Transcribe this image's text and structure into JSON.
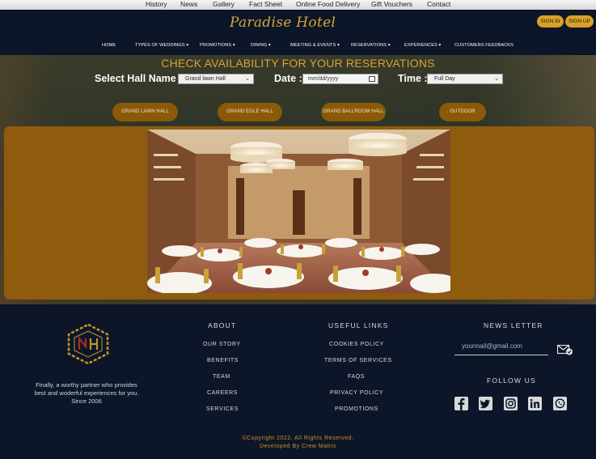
{
  "topbar": {
    "links": [
      "History",
      "News",
      "Gallery",
      "Fact Sheet",
      "Online Food Delivery",
      "Gift Vouchers",
      "Contact"
    ]
  },
  "header": {
    "logo": "Paradise Hotel",
    "signin_label": "SIGN IN",
    "signup_label": "SIGN UP",
    "nav": [
      "HOME",
      "TYPES OF WEDDINGS ▾",
      "PROMOTIONS ▾",
      "DINING ▾",
      "MEETING & EVENTS ▾",
      "RESERVATIONS ▾",
      "EXPERIENCES ▾",
      "CUSTOMERS FEEDBACKS"
    ]
  },
  "reservation": {
    "title": "CHECK AVAILABILITY FOR YOUR RESERVATIONS",
    "hall_label": "Select Hall Name :",
    "hall_value": "Grand lawn Hall",
    "date_label": "Date :",
    "date_value": "mm/dd/yyyy",
    "time_label": "Time :",
    "time_value": "Full Day",
    "hall_buttons": [
      "GRAND LAWN HALL",
      "GRAND EGLE HALL",
      "GRAND BALLROOM HALL",
      "OUTDOOR"
    ]
  },
  "footer": {
    "tagline": "Finally, a worthy partner who provides best and woderful experiences for you.",
    "since": "Since 2006",
    "about_heading": "ABOUT",
    "about_links": [
      "OUR STORY",
      "BENEFITS",
      "TEAM",
      "CAREERS",
      "SERVICES"
    ],
    "useful_heading": "USEFUL LINKS",
    "useful_links": [
      "COOKIES POLICY",
      "TERMS OF SERVICES",
      "FAQS",
      "PRIVACY POLICY",
      "PROMOTIONS"
    ],
    "newsletter_heading": "NEWS LETTER",
    "email_placeholder": "yourmail@gmail.com",
    "follow_heading": "FOLLOW US",
    "social_icons": [
      "facebook-icon",
      "twitter-icon",
      "instagram-icon",
      "linkedin-icon",
      "whatsapp-icon"
    ],
    "copyright": "©Copyright 2022. All Rights Reserved.",
    "developed_by": "Developed By Crew Matrix"
  },
  "colors": {
    "accent_gold": "#d9a127",
    "navy": "#0c1628",
    "panel_brown": "#8e5c0c"
  }
}
